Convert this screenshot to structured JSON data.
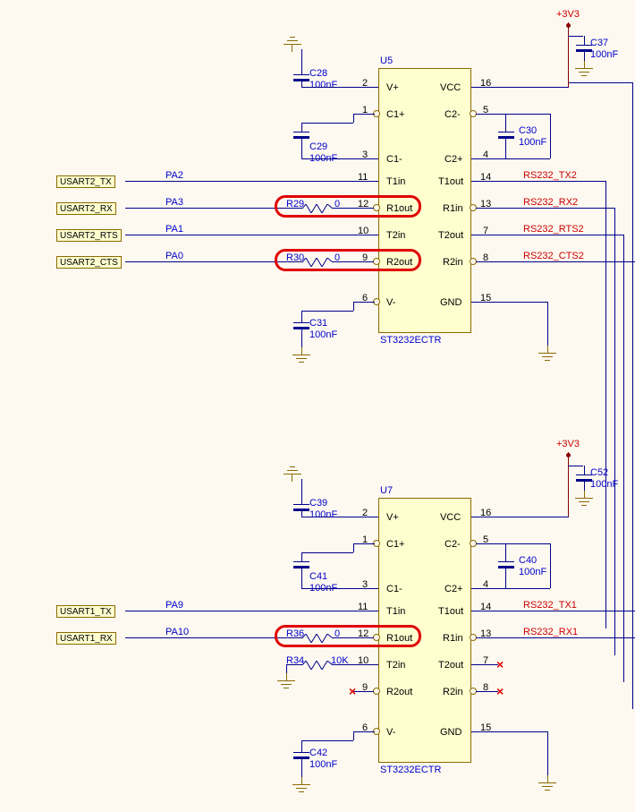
{
  "power_rail": "+3V3",
  "ic_upper": {
    "ref": "U5",
    "part": "ST3232ECTR",
    "pins_left": [
      {
        "num": "2",
        "name": "V+"
      },
      {
        "num": "1",
        "name": "C1+"
      },
      {
        "num": "3",
        "name": "C1-"
      },
      {
        "num": "11",
        "name": "T1in"
      },
      {
        "num": "12",
        "name": "R1out"
      },
      {
        "num": "10",
        "name": "T2in"
      },
      {
        "num": "9",
        "name": "R2out"
      },
      {
        "num": "6",
        "name": "V-"
      }
    ],
    "pins_right": [
      {
        "num": "16",
        "name": "VCC"
      },
      {
        "num": "5",
        "name": "C2-"
      },
      {
        "num": "4",
        "name": "C2+"
      },
      {
        "num": "14",
        "name": "T1out"
      },
      {
        "num": "13",
        "name": "R1in"
      },
      {
        "num": "7",
        "name": "T2out"
      },
      {
        "num": "8",
        "name": "R2in"
      },
      {
        "num": "15",
        "name": "GND"
      }
    ]
  },
  "ic_lower": {
    "ref": "U7",
    "part": "ST3232ECTR",
    "pins_left": [
      {
        "num": "2",
        "name": "V+"
      },
      {
        "num": "1",
        "name": "C1+"
      },
      {
        "num": "3",
        "name": "C1-"
      },
      {
        "num": "11",
        "name": "T1in"
      },
      {
        "num": "12",
        "name": "R1out"
      },
      {
        "num": "10",
        "name": "T2in"
      },
      {
        "num": "9",
        "name": "R2out"
      },
      {
        "num": "6",
        "name": "V-"
      }
    ],
    "pins_right": [
      {
        "num": "16",
        "name": "VCC"
      },
      {
        "num": "5",
        "name": "C2-"
      },
      {
        "num": "4",
        "name": "C2+"
      },
      {
        "num": "14",
        "name": "T1out"
      },
      {
        "num": "13",
        "name": "R1in"
      },
      {
        "num": "7",
        "name": "T2out"
      },
      {
        "num": "8",
        "name": "R2in"
      },
      {
        "num": "15",
        "name": "GND"
      }
    ]
  },
  "caps": {
    "C28": {
      "ref": "C28",
      "val": "100nF"
    },
    "C29": {
      "ref": "C29",
      "val": "100nF"
    },
    "C30": {
      "ref": "C30",
      "val": "100nF"
    },
    "C31": {
      "ref": "C31",
      "val": "100nF"
    },
    "C37": {
      "ref": "C37",
      "val": "100nF"
    },
    "C39": {
      "ref": "C39",
      "val": "100nF"
    },
    "C40": {
      "ref": "C40",
      "val": "100nF"
    },
    "C41": {
      "ref": "C41",
      "val": "100nF"
    },
    "C42": {
      "ref": "C42",
      "val": "100nF"
    },
    "C52": {
      "ref": "C52",
      "val": "100nF"
    }
  },
  "resistors": {
    "R29": {
      "ref": "R29",
      "val": "0"
    },
    "R30": {
      "ref": "R30",
      "val": "0"
    },
    "R34": {
      "ref": "R34",
      "val": "10K"
    },
    "R36": {
      "ref": "R36",
      "val": "0"
    }
  },
  "nets_upper": {
    "tx_mcu": "PA2",
    "rx_mcu": "PA3",
    "rts_mcu": "PA1",
    "cts_mcu": "PA0",
    "tx_lbl": "USART2_TX",
    "rx_lbl": "USART2_RX",
    "rts_lbl": "USART2_RTS",
    "cts_lbl": "USART2_CTS",
    "tx_out": "RS232_TX2",
    "rx_in": "RS232_RX2",
    "rts_out": "RS232_RTS2",
    "cts_in": "RS232_CTS2"
  },
  "nets_lower": {
    "tx_mcu": "PA9",
    "rx_mcu": "PA10",
    "tx_lbl": "USART1_TX",
    "rx_lbl": "USART1_RX",
    "tx_out": "RS232_TX1",
    "rx_in": "RS232_RX1"
  }
}
